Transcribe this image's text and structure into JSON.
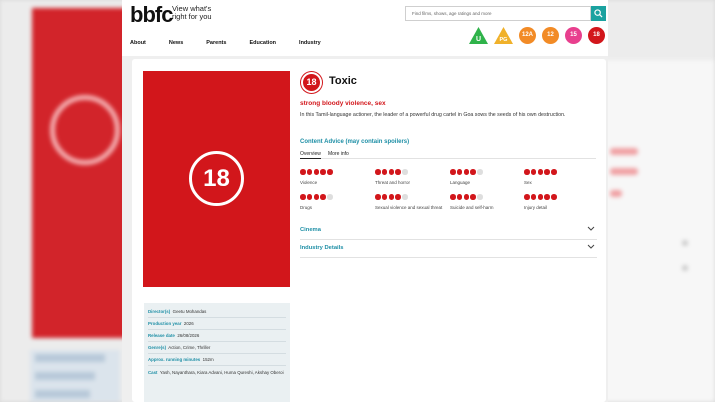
{
  "header": {
    "logo": "bbfc",
    "tagline": "View what's right for you",
    "search_placeholder": "Find films, shows, age ratings and more",
    "nav": [
      "About",
      "News",
      "Parents",
      "Education",
      "Industry"
    ]
  },
  "ratings": [
    {
      "label": "U",
      "color": "#2fb34a",
      "shape": "triangle"
    },
    {
      "label": "PG",
      "color": "#f0b12a",
      "shape": "triangle"
    },
    {
      "label": "12A",
      "color": "#f28b26",
      "shape": "circle"
    },
    {
      "label": "12",
      "color": "#f28b26",
      "shape": "circle"
    },
    {
      "label": "15",
      "color": "#e83f8e",
      "shape": "circle"
    },
    {
      "label": "18",
      "color": "#d2161b",
      "shape": "circle"
    }
  ],
  "film": {
    "rating": "18",
    "title": "Toxic",
    "advice": "strong bloody violence, sex",
    "synopsis": "In this Tamil-language actioner, the leader of a powerful drug cartel in Goa sows the seeds of his own destruction."
  },
  "content_advice": {
    "heading": "Content Advice (may contain spoilers)",
    "tabs": [
      "Overview",
      "More info"
    ],
    "issues": [
      {
        "label": "Violence",
        "level": 5
      },
      {
        "label": "Threat and horror",
        "level": 4
      },
      {
        "label": "Language",
        "level": 4
      },
      {
        "label": "Sex",
        "level": 5
      },
      {
        "label": "Drugs",
        "level": 4
      },
      {
        "label": "Sexual violence and sexual threat",
        "level": 4
      },
      {
        "label": "Suicide and self-harm",
        "level": 4
      },
      {
        "label": "Injury detail",
        "level": 5
      }
    ]
  },
  "accordions": [
    "Cinema",
    "Industry Details"
  ],
  "details": [
    {
      "key": "Director(s)",
      "value": "Geetu Mohandas"
    },
    {
      "key": "Production year",
      "value": "2026"
    },
    {
      "key": "Release date",
      "value": "26/08/2026"
    },
    {
      "key": "Genre(s)",
      "value": "Action, Crime, Thriller"
    },
    {
      "key": "Approx. running minutes",
      "value": "152m"
    },
    {
      "key": "Cast",
      "value": "Yash, Nayanthara, Kiara Advani, Huma Qureshi, Akshay Oberoi"
    }
  ],
  "colors": {
    "brand_red": "#d2161b",
    "teal": "#1e8fa6",
    "search_teal": "#1ba2a0"
  }
}
